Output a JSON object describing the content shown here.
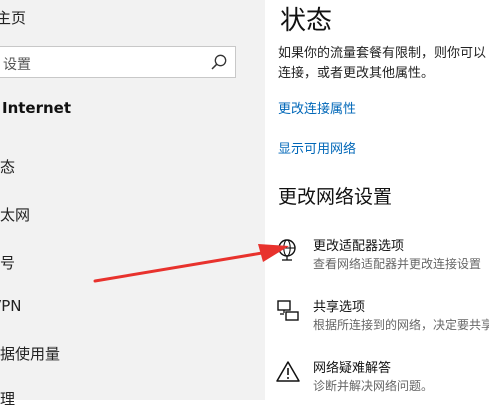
{
  "sidebar": {
    "home": "主页",
    "search_placeholder": "设置",
    "section_title": "Internet",
    "items": [
      {
        "label": "状态"
      },
      {
        "label": "以太网"
      },
      {
        "label": "拨号"
      },
      {
        "label": "VPN"
      },
      {
        "label": "数据使用量"
      },
      {
        "label": "代理"
      }
    ]
  },
  "main": {
    "title": "状态",
    "description_line1": "如果你的流量套餐有限制，则你可以",
    "description_line2": "连接，或者更改其他属性。",
    "link_change_properties": "更改连接属性",
    "link_show_networks": "显示可用网络",
    "section_title": "更改网络设置",
    "settings": [
      {
        "title": "更改适配器选项",
        "desc": "查看网络适配器并更改连接设置",
        "icon": "adapter-globe-icon"
      },
      {
        "title": "共享选项",
        "desc": "根据所连接到的网络，决定要共享",
        "icon": "sharing-icon"
      },
      {
        "title": "网络疑难解答",
        "desc": "诊断并解决网络问题。",
        "icon": "warning-icon"
      }
    ]
  },
  "annotation": {
    "color": "#e8322d"
  }
}
